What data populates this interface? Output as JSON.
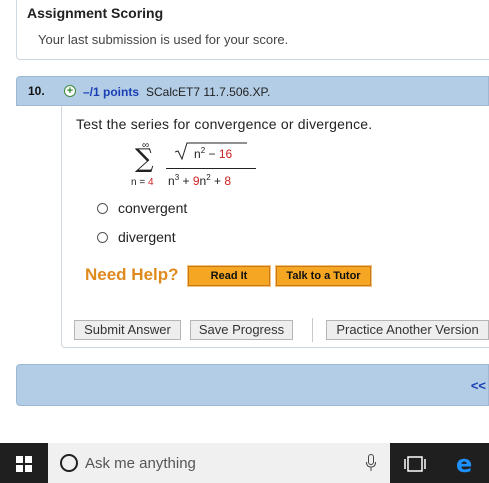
{
  "scoring": {
    "title": "Assignment Scoring",
    "text": "Your last submission is used for your score."
  },
  "question": {
    "number": "10.",
    "points": "–/1 points",
    "ref": "SCalcET7 11.7.506.XP.",
    "prompt": "Test the series for convergence or divergence.",
    "math": {
      "sum_upper": "∞",
      "sum_lower_var": "n =",
      "sum_lower_val": "4",
      "numerator_var": "n",
      "numerator_exp": "2",
      "numerator_op": " − ",
      "numerator_const": "16",
      "denominator_a": "n",
      "denominator_a_exp": "3",
      "denominator_op1": " + ",
      "denominator_b_coef": "9",
      "denominator_b_var": "n",
      "denominator_b_exp": "2",
      "denominator_op2": " + ",
      "denominator_const": "8"
    },
    "options": [
      "convergent",
      "divergent"
    ]
  },
  "help": {
    "label": "Need Help?",
    "read_it": "Read It",
    "talk_tutor": "Talk to a Tutor"
  },
  "actions": {
    "submit": "Submit Answer",
    "save": "Save Progress",
    "practice": "Practice Another Version"
  },
  "nav": {
    "prev": "<<"
  },
  "taskbar": {
    "search_placeholder": "Ask me anything"
  },
  "colors": {
    "header_blue": "#b3cde6",
    "link_blue": "#1a3fb5",
    "help_orange": "#e08a1e",
    "button_orange": "#f5a623",
    "math_red": "#cc1f1f"
  }
}
